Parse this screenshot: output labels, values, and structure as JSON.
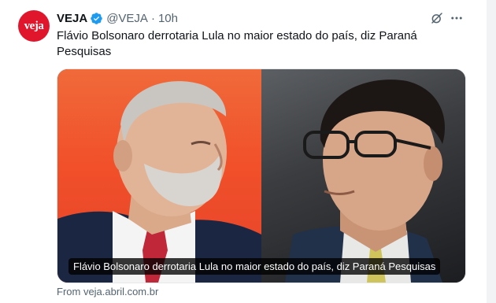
{
  "tweet": {
    "avatar_text": "veja",
    "display_name": "VEJA",
    "handle": "@VEJA",
    "separator": "·",
    "time": "10h",
    "text": "Flávio Bolsonaro derrotaria Lula no maior estado do país, diz Paraná Pesquisas",
    "icons": [
      "verified-badge-icon",
      "grok-icon",
      "more-icon"
    ]
  },
  "card": {
    "caption": "Flávio Bolsonaro derrotaria Lula no maior estado do país, diz Paraná Pesquisas",
    "source": "From veja.abril.com.br"
  },
  "colors": {
    "brand": "#e0172c",
    "verified": "#1d9bf0",
    "text": "#0f1419",
    "secondary": "#536471"
  }
}
